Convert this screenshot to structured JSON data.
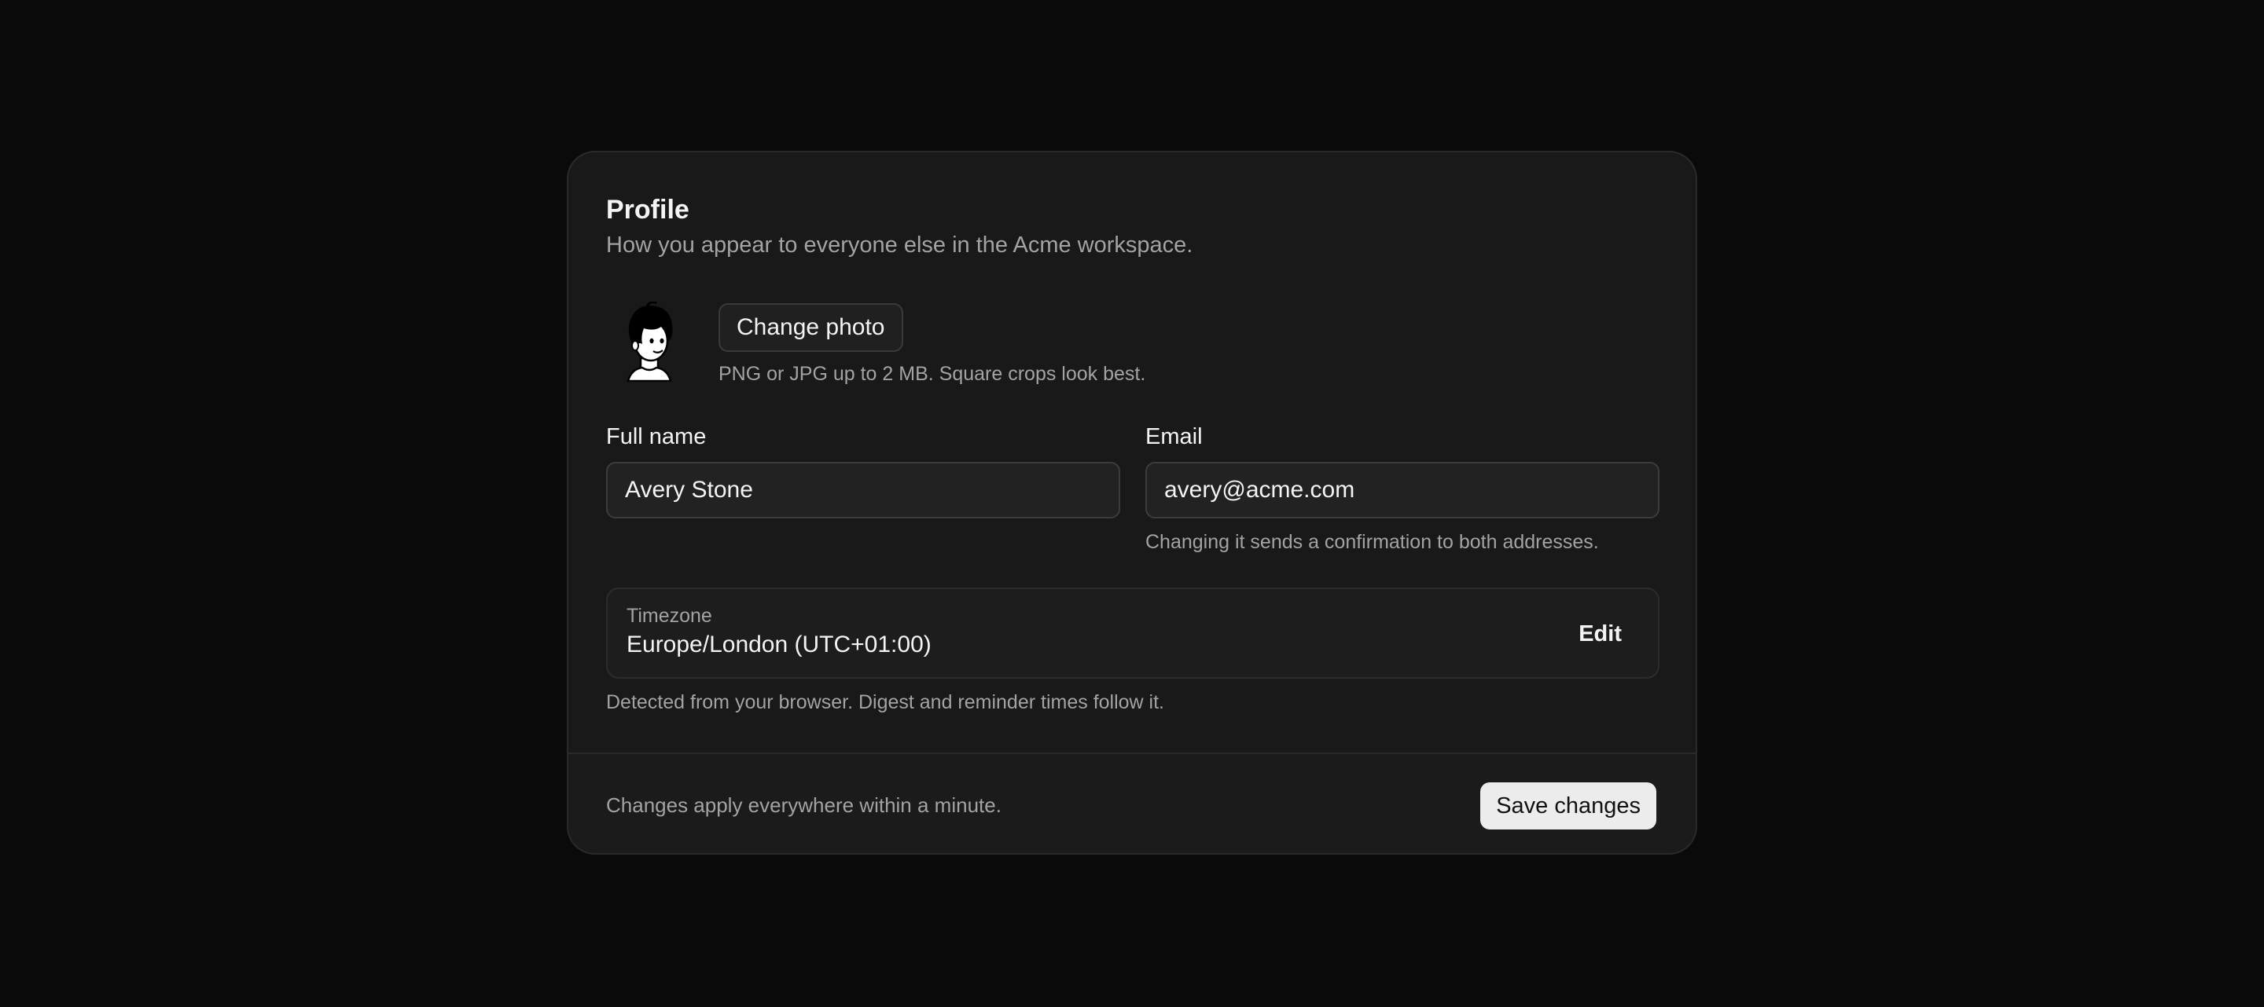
{
  "profile": {
    "title": "Profile",
    "subtitle": "How you appear to everyone else in the Acme workspace."
  },
  "photo": {
    "avatar_icon": "cartoon-avatar-icon",
    "change_label": "Change photo",
    "hint": "PNG or JPG up to 2 MB. Square crops look best."
  },
  "fields": {
    "full_name": {
      "label": "Full name",
      "value": "Avery Stone"
    },
    "email": {
      "label": "Email",
      "value": "avery@acme.com",
      "hint": "Changing it sends a confirmation to both addresses."
    }
  },
  "timezone": {
    "label": "Timezone",
    "value": "Europe/London (UTC+01:00)",
    "edit_label": "Edit",
    "hint": "Detected from your browser. Digest and reminder times follow it."
  },
  "footer": {
    "note": "Changes apply everywhere within a minute.",
    "save_label": "Save changes"
  },
  "colors": {
    "background": "#0a0a0a",
    "card": "#191919",
    "primary_button": "#ececec",
    "muted_text": "#a3a3a3"
  }
}
